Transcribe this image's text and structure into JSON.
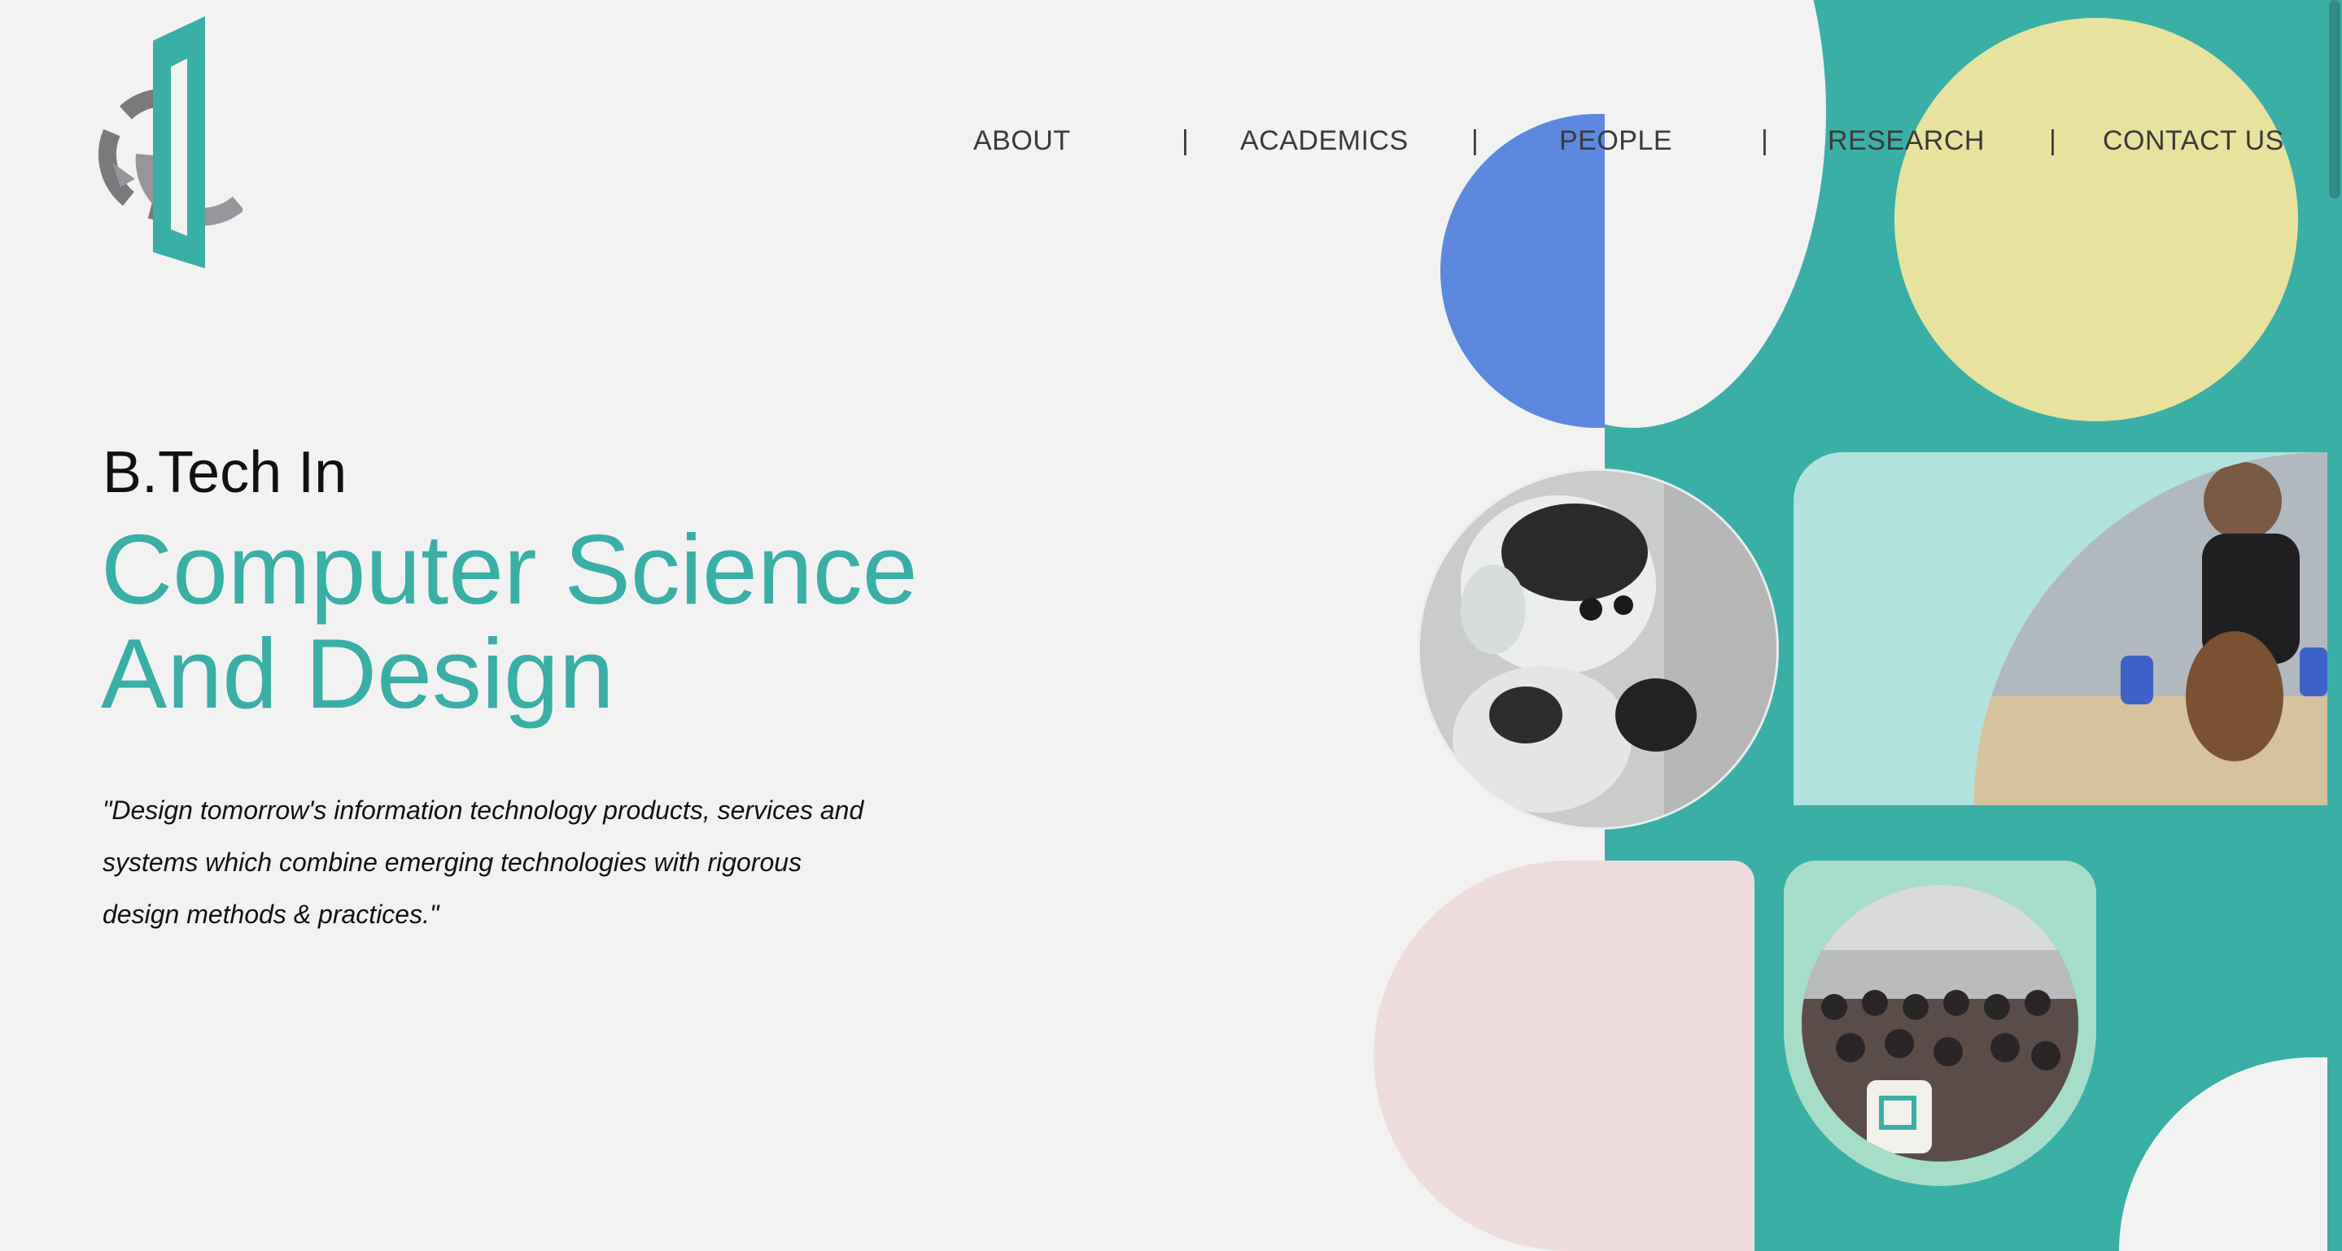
{
  "nav": {
    "items": [
      {
        "label": "ABOUT"
      },
      {
        "label": "ACADEMICS"
      },
      {
        "label": "PEOPLE"
      },
      {
        "label": "RESEARCH"
      },
      {
        "label": "CONTACT US"
      }
    ],
    "separator": "|"
  },
  "hero": {
    "pre_title": "B.Tech In",
    "title_line1": "Computer Science",
    "title_line2": "And Design",
    "quote": "\"Design tomorrow's information technology products, services and systems which combine emerging technologies with rigorous design methods & practices.\""
  },
  "colors": {
    "teal": "#3aafa6",
    "blue": "#5c88e0",
    "yellow": "#e8e29f",
    "mint": "#b1e2dd",
    "pink": "#efdcdd",
    "background": "#f2f2f2"
  },
  "icons": {
    "logo": "cd-logo-icon"
  }
}
